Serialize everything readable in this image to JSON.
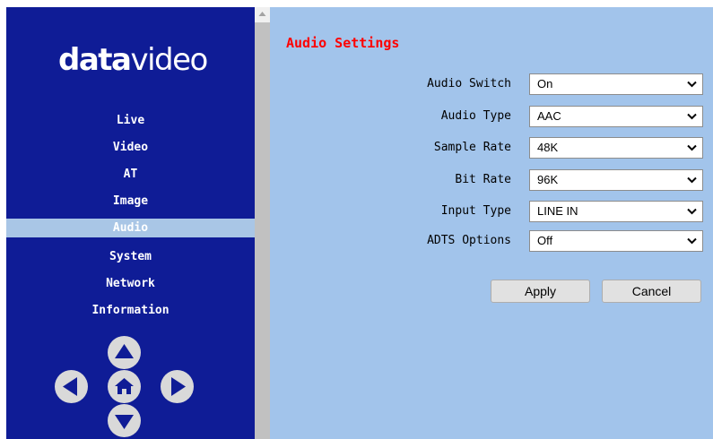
{
  "logo": {
    "part1": "data",
    "part2": "video"
  },
  "sidebar": {
    "items": [
      {
        "label": "Live",
        "active": false
      },
      {
        "label": "Video",
        "active": false
      },
      {
        "label": "AT",
        "active": false
      },
      {
        "label": "Image",
        "active": false
      },
      {
        "label": "Audio",
        "active": true
      },
      {
        "label": "System",
        "active": false
      },
      {
        "label": "Network",
        "active": false
      },
      {
        "label": "Information",
        "active": false
      }
    ],
    "dpad": [
      "arrow-up-icon",
      "arrow-left-icon",
      "home-icon",
      "arrow-right-icon",
      "arrow-down-icon"
    ]
  },
  "main": {
    "title": "Audio Settings",
    "fields": [
      {
        "label": "Audio Switch",
        "value": "On"
      },
      {
        "label": "Audio Type",
        "value": "AAC"
      },
      {
        "label": "Sample Rate",
        "value": "48K"
      },
      {
        "label": "Bit Rate",
        "value": "96K"
      },
      {
        "label": "Input Type",
        "value": "LINE IN"
      },
      {
        "label": "ADTS Options",
        "value": "Off"
      }
    ],
    "apply_label": "Apply",
    "cancel_label": "Cancel"
  },
  "colors": {
    "sidebar_bg": "#0f1c96",
    "active_item_bg": "#a9c6e6",
    "main_bg": "#a2c4eb",
    "title_color": "#ff0000"
  }
}
